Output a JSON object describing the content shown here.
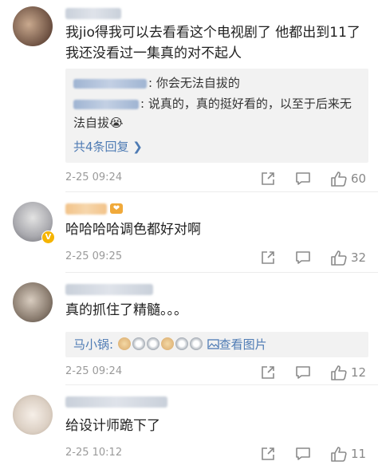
{
  "comments": [
    {
      "text": "我jio得我可以去看看这个电视剧了 他都出到11了我还没看过一集真的对不起人",
      "replies": [
        {
          "text": ": 你会无法自拔的"
        },
        {
          "text": ": 说真的，真的挺好看的，以至于后来无法自拔"
        }
      ],
      "reply_emoji": "😭",
      "more_replies": "共4条回复 ❯",
      "timestamp": "2-25 09:24",
      "likes": "60"
    },
    {
      "text": "哈哈哈哈调色都好对啊",
      "timestamp": "2-25 09:25",
      "likes": "32"
    },
    {
      "text": "真的抓住了精髓。。。",
      "reply_author": "马小锅:",
      "view_image": "查看图片",
      "timestamp": "2-25 09:24",
      "likes": "12"
    },
    {
      "text": "给设计师跪下了",
      "timestamp": "2-25 10:12",
      "likes": "11"
    }
  ],
  "colors": {
    "link": "#4e7bb4",
    "meta": "#9a9a9a",
    "text": "#222222",
    "reply_bg": "#f2f2f2"
  },
  "icons": [
    "share-icon",
    "comment-icon",
    "thumbs-up-icon",
    "image-icon",
    "chevron-right-icon"
  ]
}
